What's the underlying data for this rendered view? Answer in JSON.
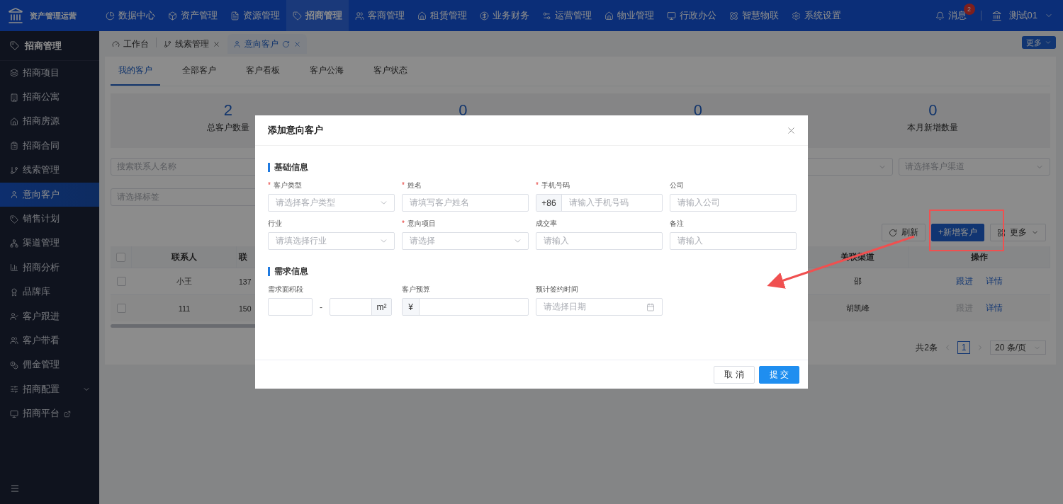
{
  "app": {
    "title": "资产管理运营"
  },
  "top_nav": [
    {
      "label": "数据中心",
      "selected": false
    },
    {
      "label": "资产管理",
      "selected": false
    },
    {
      "label": "资源管理",
      "selected": false
    },
    {
      "label": "招商管理",
      "selected": true
    },
    {
      "label": "客商管理",
      "selected": false
    },
    {
      "label": "租赁管理",
      "selected": false
    },
    {
      "label": "业务财务",
      "selected": false
    },
    {
      "label": "运营管理",
      "selected": false
    },
    {
      "label": "物业管理",
      "selected": false
    },
    {
      "label": "行政办公",
      "selected": false
    },
    {
      "label": "智慧物联",
      "selected": false
    },
    {
      "label": "系统设置",
      "selected": false
    }
  ],
  "header_right": {
    "messages": "消息",
    "message_badge": "2",
    "user": "测试01"
  },
  "sidebar": {
    "title": "招商管理",
    "items": [
      {
        "label": "招商项目",
        "selected": false
      },
      {
        "label": "招商公寓",
        "selected": false
      },
      {
        "label": "招商房源",
        "selected": false
      },
      {
        "label": "招商合同",
        "selected": false
      },
      {
        "label": "线索管理",
        "selected": false
      },
      {
        "label": "意向客户",
        "selected": true
      },
      {
        "label": "销售计划",
        "selected": false
      },
      {
        "label": "渠道管理",
        "selected": false
      },
      {
        "label": "招商分析",
        "selected": false
      },
      {
        "label": "品牌库",
        "selected": false
      },
      {
        "label": "客户跟进",
        "selected": false
      },
      {
        "label": "客户带看",
        "selected": false
      },
      {
        "label": "佣金管理",
        "selected": false
      },
      {
        "label": "招商配置",
        "selected": false,
        "kind": "group"
      },
      {
        "label": "招商平台",
        "selected": false,
        "kind": "external"
      }
    ]
  },
  "page_tabs": [
    {
      "label": "工作台",
      "selected": false,
      "kind": "home"
    },
    {
      "label": "线索管理",
      "selected": false,
      "kind": "closable"
    },
    {
      "label": "意向客户",
      "selected": true,
      "kind": "current"
    }
  ],
  "more_button": "更多",
  "sub_tabs": [
    {
      "label": "我的客户",
      "selected": true
    },
    {
      "label": "全部客户",
      "selected": false
    },
    {
      "label": "客户看板",
      "selected": false
    },
    {
      "label": "客户公海",
      "selected": false
    },
    {
      "label": "客户状态",
      "selected": false
    }
  ],
  "stats": [
    {
      "value": "2",
      "label": "总客户数量"
    },
    {
      "value": "0"
    },
    {
      "value": "0"
    },
    {
      "value": "0",
      "label": "本月新增数量"
    }
  ],
  "filters": [
    {
      "kind": "input",
      "placeholder": "搜索联系人名称"
    },
    {
      "kind": "select"
    },
    {
      "kind": "select",
      "placeholder": "请选择客户渠道"
    },
    {
      "kind": "input",
      "placeholder": "请选择标签"
    }
  ],
  "toolbar": {
    "refresh": "刷新",
    "add": "+新增客户",
    "more": "更多"
  },
  "table": {
    "columns": [
      "联系人",
      "联",
      "关联渠道",
      "操作"
    ],
    "header_checked": false,
    "rows": [
      {
        "checked": false,
        "cells": [
          "小王",
          "137",
          "邵"
        ],
        "actions": [
          {
            "label": "跟进",
            "disabled": false
          },
          {
            "label": "详情",
            "disabled": false
          }
        ]
      },
      {
        "checked": false,
        "cells": [
          "111",
          "150",
          "胡凯峰"
        ],
        "actions": [
          {
            "label": "跟进",
            "disabled": true
          },
          {
            "label": "详情",
            "disabled": false
          }
        ]
      }
    ]
  },
  "pagination": {
    "total": "共2条",
    "page": "1",
    "page_size": "20 条/页"
  },
  "dialog": {
    "title": "添加意向客户",
    "sections": [
      {
        "title": "基础信息",
        "fields": [
          {
            "kind": "select",
            "label": "客户类型",
            "required": true,
            "placeholder": "请选择客户类型"
          },
          {
            "kind": "input",
            "label": "姓名",
            "required": true,
            "placeholder": "请填写客户姓名"
          },
          {
            "kind": "phone",
            "label": "手机号码",
            "required": true,
            "prefix": "+86",
            "placeholder": "请输入手机号码"
          },
          {
            "kind": "input",
            "label": "公司",
            "required": false,
            "placeholder": "请输入公司"
          },
          {
            "kind": "select",
            "label": "行业",
            "required": false,
            "placeholder": "请填选择行业"
          },
          {
            "kind": "select",
            "label": "意向项目",
            "required": true,
            "placeholder": "请选择"
          },
          {
            "kind": "input",
            "label": "成交率",
            "required": false,
            "placeholder": "请输入"
          },
          {
            "kind": "input",
            "label": "备注",
            "required": false,
            "placeholder": "请输入"
          }
        ]
      },
      {
        "title": "需求信息",
        "fields": [
          {
            "kind": "range",
            "label": "需求面积段",
            "required": false,
            "separator": "-",
            "suffix": "m²"
          },
          {
            "kind": "currency",
            "label": "客户预算",
            "required": false,
            "prefix": "¥"
          },
          {
            "kind": "date",
            "label": "预计签约时间",
            "required": false,
            "placeholder": "请选择日期"
          }
        ]
      }
    ],
    "required_mark": "*",
    "cancel": "取 消",
    "submit": "提 交"
  }
}
